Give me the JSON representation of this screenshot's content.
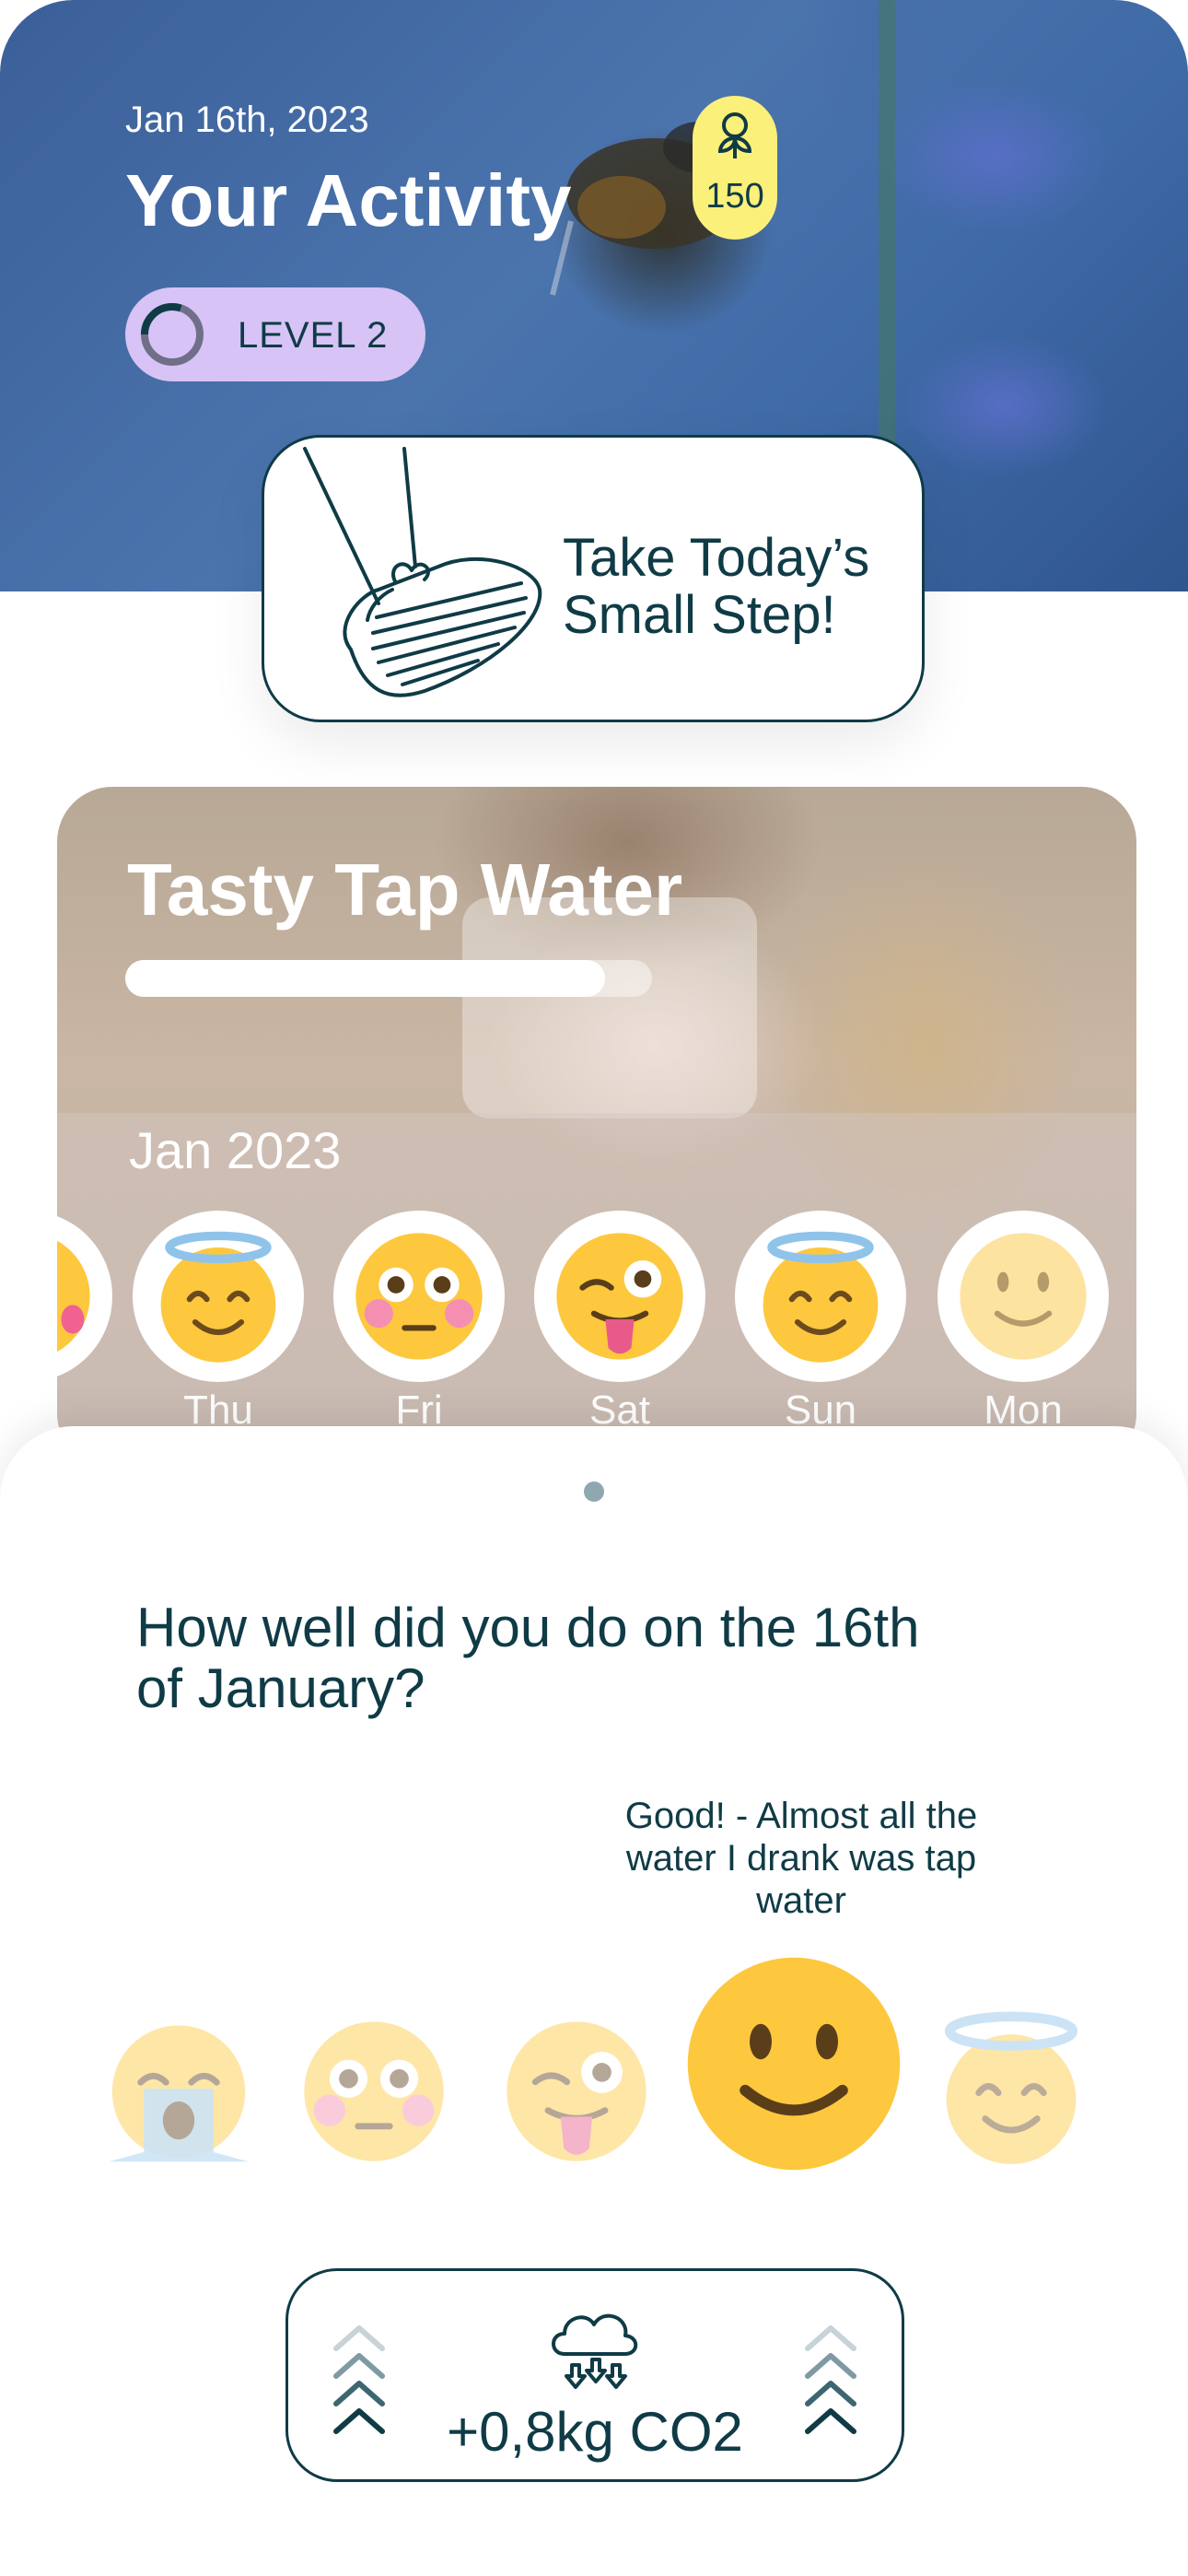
{
  "header": {
    "date": "Jan 16th, 2023",
    "title": "Your Activity",
    "points": "150",
    "level_label": "LEVEL 2",
    "level_progress": 0.3
  },
  "step_card": {
    "line1": "Take Today’s",
    "line2": "Small Step!"
  },
  "challenge": {
    "title": "Tasty Tap Water",
    "progress": 0.91,
    "month": "Jan 2023",
    "days": [
      {
        "label": "Thu",
        "emoji": "angel-face-icon"
      },
      {
        "label": "Fri",
        "emoji": "flushed-face-icon"
      },
      {
        "label": "Sat",
        "emoji": "winking-tongue-face-icon"
      },
      {
        "label": "Sun",
        "emoji": "angel-face-icon"
      },
      {
        "label": "Mon",
        "emoji": "slightly-smiling-face-icon"
      }
    ]
  },
  "sheet": {
    "question": "How well did you do on the 16th of January?",
    "selected_tooltip": "Good! - Almost all the water I drank was tap water",
    "ratings": [
      "crying-face-icon",
      "flushed-face-icon",
      "winking-tongue-face-icon",
      "slightly-smiling-face-icon",
      "angel-face-icon"
    ],
    "selected_index": 3
  },
  "co2": {
    "value": "+0,8kg CO2"
  },
  "colors": {
    "text_dark": "#0f3b46",
    "level_pill": "#d7c3f6",
    "points_pill": "#fbf07a",
    "emoji_yellow": "#fdc83e",
    "halo_blue": "#8fc3ea"
  }
}
